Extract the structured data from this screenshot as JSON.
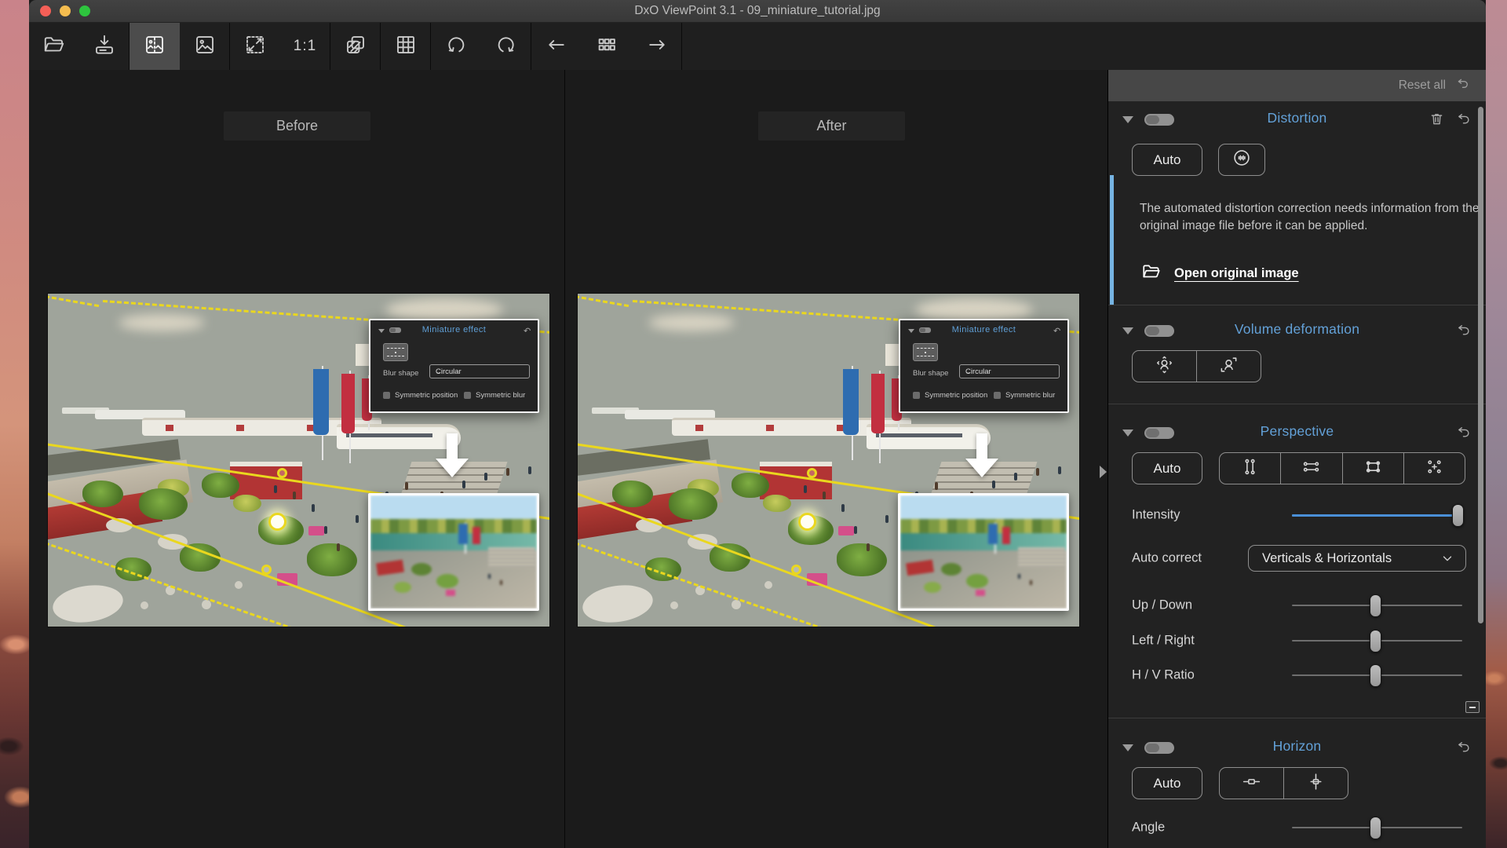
{
  "window": {
    "title": "DxO ViewPoint 3.1 - 09_miniature_tutorial.jpg"
  },
  "toolbar": {
    "zoom_ratio_label": "1:1"
  },
  "viewer": {
    "before_label": "Before",
    "after_label": "After"
  },
  "miniature_overlay": {
    "title": "Miniature effect",
    "blur_shape_label": "Blur shape",
    "blur_shape_value": "Circular",
    "symmetric_position_label": "Symmetric position",
    "symmetric_blur_label": "Symmetric blur"
  },
  "sidebar": {
    "reset_all_label": "Reset all",
    "distortion": {
      "title": "Distortion",
      "auto_label": "Auto",
      "info_text": "The automated distortion correction needs information from the original image file before it can be applied.",
      "open_link_label": "Open original image"
    },
    "volume_deformation": {
      "title": "Volume deformation"
    },
    "perspective": {
      "title": "Perspective",
      "auto_label": "Auto",
      "intensity_label": "Intensity",
      "auto_correct_label": "Auto correct",
      "auto_correct_value": "Verticals & Horizontals",
      "up_down_label": "Up / Down",
      "left_right_label": "Left / Right",
      "hv_ratio_label": "H / V Ratio"
    },
    "horizon": {
      "title": "Horizon",
      "auto_label": "Auto",
      "angle_label": "Angle"
    }
  },
  "slider_states": {
    "intensity_percent": 100,
    "up_down_percent": 50,
    "left_right_percent": 50,
    "hv_ratio_percent": 50,
    "angle_percent": 50
  },
  "colors": {
    "accent_blue": "#5f9fd6",
    "info_stripe_blue": "#76b4e3",
    "slider_blue": "#4a90d8",
    "guide_yellow": "#ead71e"
  }
}
